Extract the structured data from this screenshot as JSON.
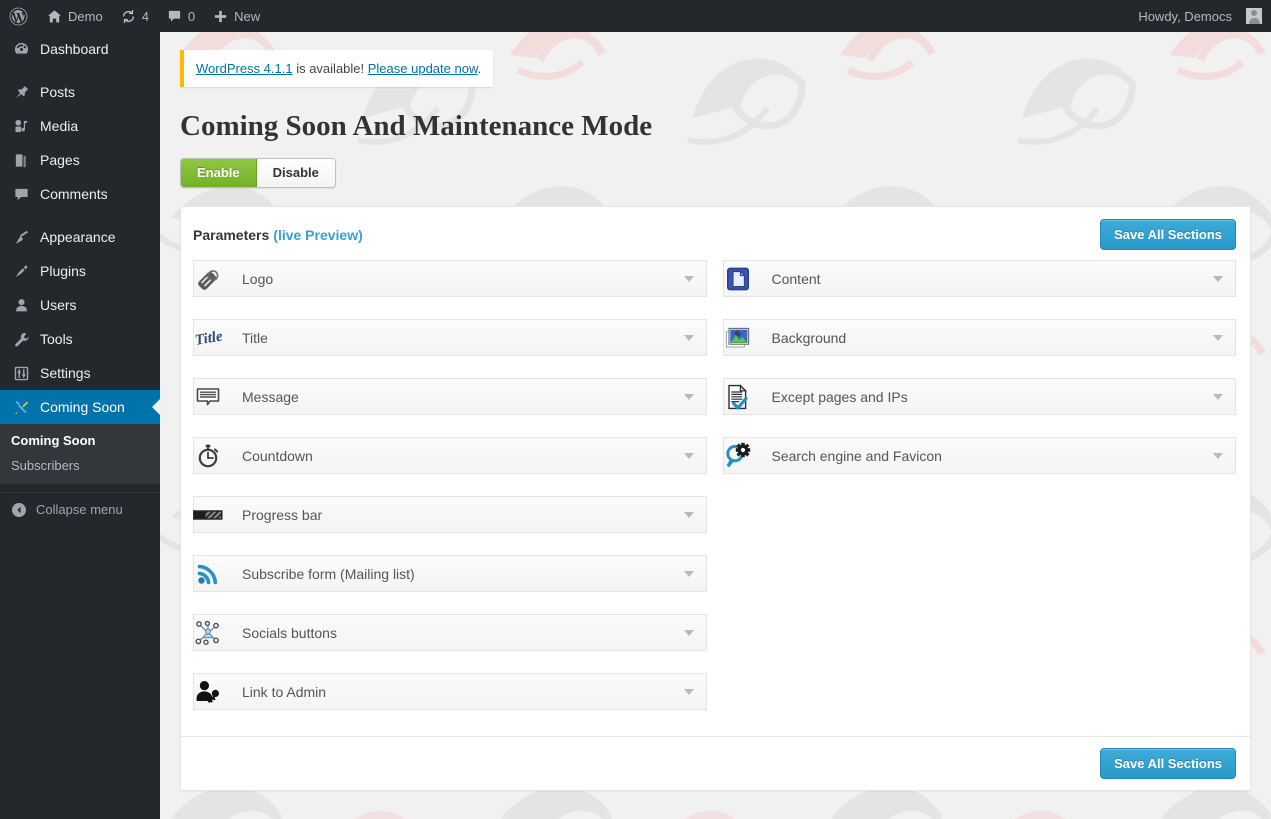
{
  "adminbar": {
    "logo_icon": "wordpress-logo-icon",
    "site_icon": "home-icon",
    "site_name": "Demo",
    "updates_icon": "updates-icon",
    "updates_count": "4",
    "comments_icon": "comment-bubble-icon",
    "comments_count": "0",
    "new_icon": "plus-icon",
    "new_label": "New",
    "howdy": "Howdy, Democs",
    "avatar_icon": "avatar"
  },
  "sidebar": {
    "items": [
      {
        "label": "Dashboard",
        "icon": "dashboard-icon",
        "current": false
      },
      {
        "label": "Posts",
        "icon": "pin-icon",
        "current": false
      },
      {
        "label": "Media",
        "icon": "media-icon",
        "current": false
      },
      {
        "label": "Pages",
        "icon": "pages-icon",
        "current": false
      },
      {
        "label": "Comments",
        "icon": "comments-icon",
        "current": false
      },
      {
        "label": "Appearance",
        "icon": "appearance-brush-icon",
        "current": false
      },
      {
        "label": "Plugins",
        "icon": "plugins-plug-icon",
        "current": false
      },
      {
        "label": "Users",
        "icon": "users-icon",
        "current": false
      },
      {
        "label": "Tools",
        "icon": "tools-wrench-icon",
        "current": false
      },
      {
        "label": "Settings",
        "icon": "settings-sliders-icon",
        "current": false
      },
      {
        "label": "Coming Soon",
        "icon": "coming-soon-tools-icon",
        "current": true
      }
    ],
    "submenu": [
      {
        "label": "Coming Soon",
        "current": true
      },
      {
        "label": "Subscribers",
        "current": false
      }
    ],
    "collapse_label": "Collapse menu",
    "collapse_icon": "collapse-arrow-icon",
    "highlight_color": "#0073aa",
    "background_color": "#23282d"
  },
  "notice": {
    "link_version": "WordPress 4.1.1",
    "middle_text": " is available! ",
    "link_update": "Please update now",
    "end_text": ".",
    "accent_color": "#ffba00"
  },
  "page": {
    "title": "Coming Soon And Maintenance Mode"
  },
  "toggle": {
    "enable_label": "Enable",
    "disable_label": "Disable",
    "active": "Enable",
    "enable_color": "#7fb832"
  },
  "panel": {
    "title": "Parameters",
    "live_preview_label": "(live Preview)",
    "save_label": "Save All Sections",
    "save_color": "#2f9fcd",
    "save_label_bottom": "Save All Sections",
    "left_sections": [
      {
        "label": "Logo",
        "icon": "logo-tag-icon"
      },
      {
        "label": "Title",
        "icon": "title-script-icon"
      },
      {
        "label": "Message",
        "icon": "message-bubble-icon"
      },
      {
        "label": "Countdown",
        "icon": "countdown-stopwatch-icon"
      },
      {
        "label": "Progress bar",
        "icon": "progress-bar-icon"
      },
      {
        "label": "Subscribe form (Mailing list)",
        "icon": "rss-feed-icon"
      },
      {
        "label": "Socials buttons",
        "icon": "social-network-icon"
      },
      {
        "label": "Link to Admin",
        "icon": "user-key-icon"
      }
    ],
    "right_sections": [
      {
        "label": "Content",
        "icon": "content-document-icon"
      },
      {
        "label": "Background",
        "icon": "background-image-icon"
      },
      {
        "label": "Except pages and IPs",
        "icon": "document-check-icon"
      },
      {
        "label": "Search engine and Favicon",
        "icon": "magnifier-gear-icon"
      }
    ]
  }
}
